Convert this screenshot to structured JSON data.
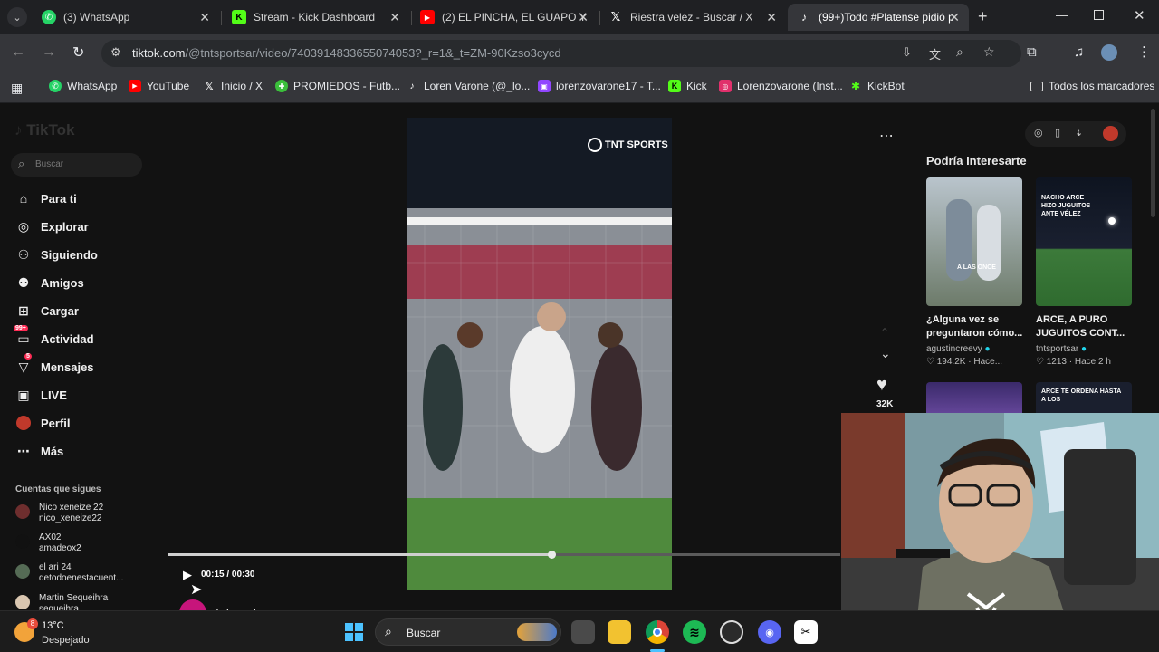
{
  "tabs": [
    {
      "label": "(3) WhatsApp",
      "icon": "whatsapp-icon",
      "color": "#25d366"
    },
    {
      "label": "Stream - Kick Dashboard",
      "icon": "kick-icon",
      "color": "#53fc18"
    },
    {
      "label": "(2) EL PINCHA, EL GUAPO Y",
      "icon": "youtube-icon",
      "color": "#ff0000"
    },
    {
      "label": "Riestra velez - Buscar / X",
      "icon": "x-icon",
      "color": "#ffffff"
    },
    {
      "label": "(99+)Todo #Platense pidió p",
      "icon": "tiktok-icon",
      "color": "#ffffff"
    }
  ],
  "address": {
    "host": "tiktok.com",
    "path": "/@tntsportsar/video/7403914833655074053?_r=1&_t=ZM-90Kzso3cycd"
  },
  "bookmarks": [
    {
      "label": "WhatsApp",
      "icon": "whatsapp-icon",
      "color": "#25d366"
    },
    {
      "label": "YouTube",
      "icon": "youtube-icon",
      "color": "#ff0000"
    },
    {
      "label": "Inicio / X",
      "icon": "x-icon",
      "color": "#ffffff"
    },
    {
      "label": "PROMIEDOS - Futb...",
      "icon": "promiedos-icon",
      "color": "#3bbf3b"
    },
    {
      "label": "Loren Varone (@_lo...",
      "icon": "tiktok-icon",
      "color": "#ffffff"
    },
    {
      "label": "lorenzovarone17 - T...",
      "icon": "twitch-icon",
      "color": "#9146ff"
    },
    {
      "label": "Kick",
      "icon": "kick-icon",
      "color": "#53fc18"
    },
    {
      "label": "Lorenzovarone (Inst...",
      "icon": "instagram-icon",
      "color": "#e1306c"
    },
    {
      "label": "KickBot",
      "icon": "kickbot-icon",
      "color": "#53fc18"
    }
  ],
  "all_bookmarks": "Todos los marcadores",
  "tiktok": {
    "logo": "TikTok",
    "search_placeholder": "Buscar",
    "nav": [
      {
        "label": "Para ti",
        "icon": "home-icon"
      },
      {
        "label": "Explorar",
        "icon": "compass-icon"
      },
      {
        "label": "Siguiendo",
        "icon": "following-icon"
      },
      {
        "label": "Amigos",
        "icon": "friends-icon"
      },
      {
        "label": "Cargar",
        "icon": "upload-icon"
      },
      {
        "label": "Actividad",
        "icon": "activity-icon",
        "badge": "99+"
      },
      {
        "label": "Mensajes",
        "icon": "messages-icon",
        "badge": "5"
      },
      {
        "label": "LIVE",
        "icon": "live-icon"
      },
      {
        "label": "Perfil",
        "icon": "profile-icon"
      },
      {
        "label": "Más",
        "icon": "more-icon"
      }
    ],
    "following_title": "Cuentas que sigues",
    "following": [
      {
        "name": "Nico xeneize 22",
        "handle": "nico_xeneize22"
      },
      {
        "name": "AX02",
        "handle": "amadeox2"
      },
      {
        "name": "el ari 24",
        "handle": "detodoenestacuent..."
      },
      {
        "name": "Martin Sequeihra",
        "handle": "sequeihra"
      }
    ],
    "video_overlay": "TNT SPORTS",
    "time": "00:15 / 00:30",
    "progress": 0.57,
    "author": "tntsportsar",
    "likes": "32K",
    "recommend_title": "Podría Interesarte",
    "recommend": [
      {
        "title": "¿Alguna vez se preguntaron cómo...",
        "author": "agustincreevy",
        "likes": "194.2K",
        "time": "Hace..."
      },
      {
        "title": "ARCE, A PURO JUGUITOS CONT...",
        "author": "tntsportsar",
        "likes": "1213",
        "time": "Hace 2 h"
      }
    ],
    "card_overlay_1": "A LAS ONCE",
    "card_overlay_2": "NACHO ARCE HIZO JUGUITOS ANTE VÉLEZ",
    "card_overlay_3": "ARCE TE ORDENA HASTA A LOS"
  },
  "taskbar": {
    "weather_temp": "13°C",
    "weather_desc": "Despejado",
    "weather_badge": "8",
    "search_label": "Buscar"
  }
}
